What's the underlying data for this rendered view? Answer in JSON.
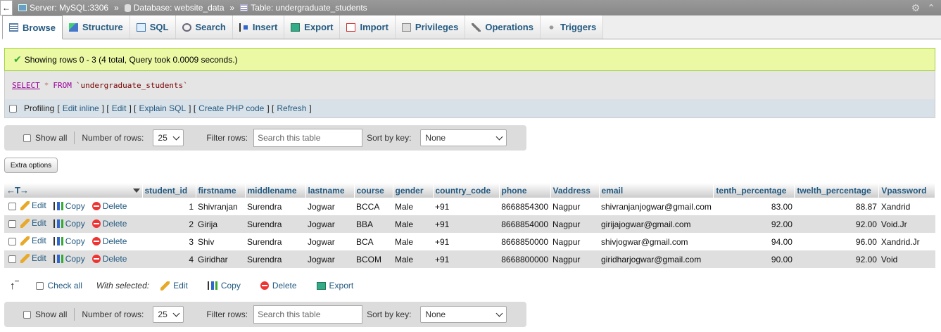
{
  "breadcrumb": {
    "back": "←",
    "server": "Server: MySQL:3306",
    "database": "Database: website_data",
    "table": "Table: undergraduate_students",
    "sep": "»"
  },
  "tabs": [
    {
      "label": "Browse",
      "icon": "browse-icon",
      "active": true
    },
    {
      "label": "Structure",
      "icon": "structure-icon"
    },
    {
      "label": "SQL",
      "icon": "sql-icon"
    },
    {
      "label": "Search",
      "icon": "search-icon"
    },
    {
      "label": "Insert",
      "icon": "insert-icon"
    },
    {
      "label": "Export",
      "icon": "export-icon"
    },
    {
      "label": "Import",
      "icon": "import-icon"
    },
    {
      "label": "Privileges",
      "icon": "privileges-icon"
    },
    {
      "label": "Operations",
      "icon": "operations-icon"
    },
    {
      "label": "Triggers",
      "icon": "triggers-icon"
    }
  ],
  "message": "Showing rows 0 - 3 (4 total, Query took 0.0009 seconds.)",
  "sql": {
    "select": "SELECT",
    "star": "*",
    "from": "FROM",
    "table": "`undergraduate_students`"
  },
  "profiling": {
    "label": "Profiling",
    "links": [
      "Edit inline",
      "Edit",
      "Explain SQL",
      "Create PHP code",
      "Refresh"
    ]
  },
  "nav": {
    "show_all": "Show all",
    "rows_label": "Number of rows:",
    "rows_value": "25",
    "filter_label": "Filter rows:",
    "filter_placeholder": "Search this table",
    "sort_label": "Sort by key:",
    "sort_value": "None"
  },
  "extra_options": "Extra options",
  "table": {
    "columns": [
      "student_id",
      "firstname",
      "middlename",
      "lastname",
      "course",
      "gender",
      "country_code",
      "phone",
      "Vaddress",
      "email",
      "tenth_percentage",
      "twelth_percentage",
      "Vpassword"
    ],
    "actions": {
      "edit": "Edit",
      "copy": "Copy",
      "delete": "Delete"
    },
    "rows": [
      [
        "1",
        "Shivranjan",
        "Surendra",
        "Jogwar",
        "BCCA",
        "Male",
        "+91",
        "8668854300",
        "Nagpur",
        "shivranjanjogwar@gmail.com",
        "83.00",
        "88.87",
        "Xandrid"
      ],
      [
        "2",
        "Girija",
        "Surendra",
        "Jogwar",
        "BBA",
        "Male",
        "+91",
        "8668854000",
        "Nagpur",
        "girijajogwar@gmail.com",
        "92.00",
        "92.00",
        "Void.Jr"
      ],
      [
        "3",
        "Shiv",
        "Surendra",
        "Jogwar",
        "BCA",
        "Male",
        "+91",
        "8668850000",
        "Nagpur",
        "shivjogwar@gmail.com",
        "94.00",
        "96.00",
        "Xandrid.Jr"
      ],
      [
        "4",
        "Giridhar",
        "Surendra",
        "Jogwar",
        "BCOM",
        "Male",
        "+91",
        "8668800000",
        "Nagpur",
        "giridharjogwar@gmail.com",
        "90.00",
        "92.00",
        "Void"
      ]
    ]
  },
  "bulk": {
    "check_all": "Check all",
    "with_selected": "With selected:",
    "edit": "Edit",
    "copy": "Copy",
    "delete": "Delete",
    "export": "Export"
  }
}
